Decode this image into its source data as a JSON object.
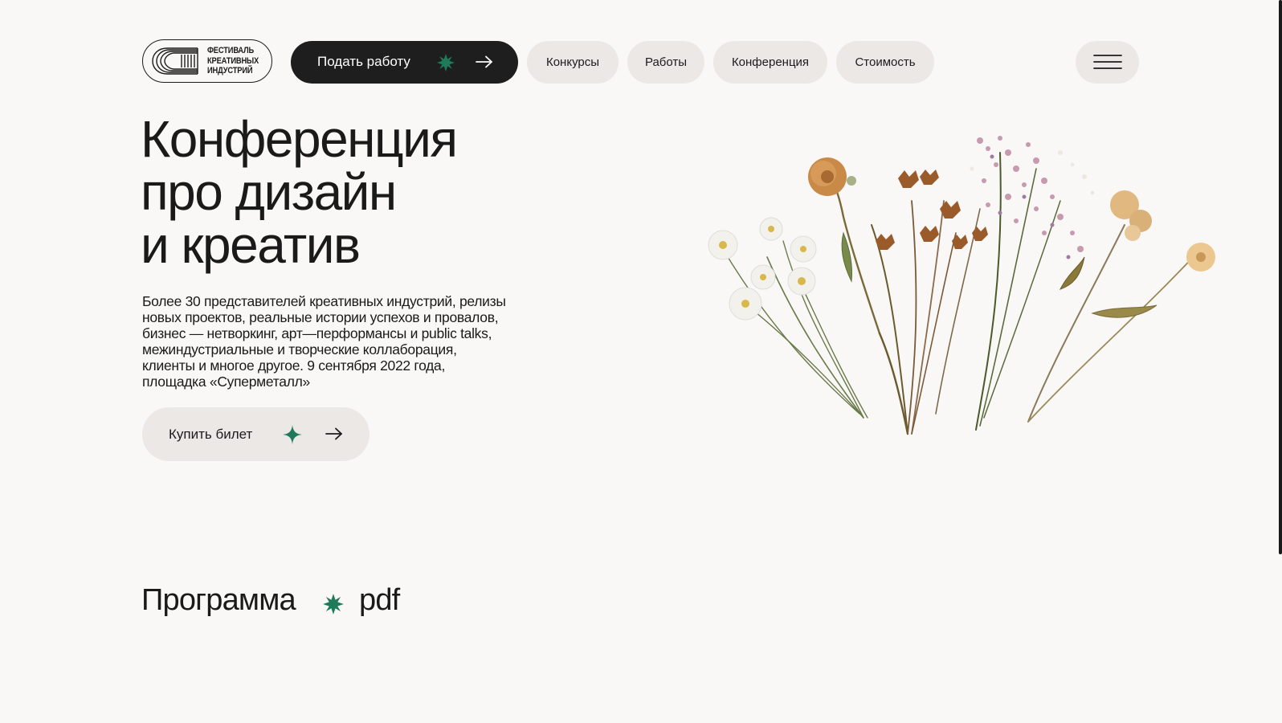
{
  "header": {
    "logo_lines": [
      "ФЕСТИВАЛЬ",
      "КРЕАТИВНЫХ",
      "ИНДУСТРИЙ"
    ],
    "submit_label": "Подать работу",
    "nav": [
      {
        "label": "Конкурсы"
      },
      {
        "label": "Работы"
      },
      {
        "label": "Конференция"
      },
      {
        "label": "Стоимость"
      }
    ],
    "menu_icon": "hamburger-icon"
  },
  "hero": {
    "title_lines": [
      "Конференция",
      "про дизайн",
      "и креатив"
    ],
    "description": "Более 30 представителей креативных индустрий, релизы новых проектов, реальные истории успехов и провалов, бизнес — нетворкинг, арт—перформансы и public talks, межиндустриальные и творческие коллаборация, клиенты и многое другое. 9 сентября 2022 года, площадка «Суперметалл»",
    "buy_label": "Купить билет"
  },
  "program": {
    "label": "Программа",
    "format": "pdf"
  },
  "colors": {
    "background": "#f9f8f6",
    "pill": "#ebe8e5",
    "dark": "#1e1e1e",
    "accent_green": "#1f7a5a"
  }
}
